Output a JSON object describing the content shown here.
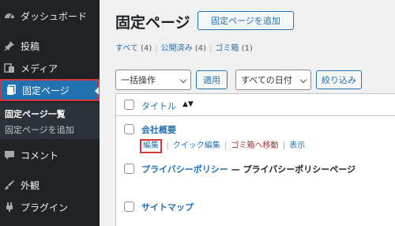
{
  "sidebar": {
    "items": [
      {
        "label": "ダッシュボード",
        "icon": "dashboard-icon"
      },
      {
        "label": "投稿",
        "icon": "pin-icon"
      },
      {
        "label": "メディア",
        "icon": "media-icon"
      },
      {
        "label": "固定ページ",
        "icon": "pages-icon"
      },
      {
        "label": "コメント",
        "icon": "comment-icon"
      },
      {
        "label": "外観",
        "icon": "brush-icon"
      },
      {
        "label": "プラグイン",
        "icon": "plugin-icon"
      }
    ],
    "submenu": {
      "current": "固定ページ一覧",
      "other": "固定ページを追加"
    }
  },
  "header": {
    "title": "固定ページ",
    "add_button": "固定ページを追加"
  },
  "views": {
    "all": "すべて",
    "all_count": "(4)",
    "published": "公開済み",
    "published_count": "(4)",
    "trash": "ゴミ箱",
    "trash_count": "(1)"
  },
  "filters": {
    "bulk_action": "一括操作",
    "apply": "適用",
    "date": "すべての日付",
    "filter": "絞り込み"
  },
  "table": {
    "header_title": "タイトル",
    "rows": [
      {
        "title": "会社概要",
        "suffix": ""
      },
      {
        "title": "プライバシーポリシー",
        "suffix": " — プライバシーポリシーページ"
      },
      {
        "title": "サイトマップ",
        "suffix": ""
      }
    ],
    "row_actions": {
      "edit": "編集",
      "quick_edit": "クイック編集",
      "trash": "ゴミ箱へ移動",
      "view": "表示"
    }
  },
  "colors": {
    "sidebar_bg": "#1d2327",
    "accent": "#2271b1",
    "highlight": "#d63638"
  }
}
